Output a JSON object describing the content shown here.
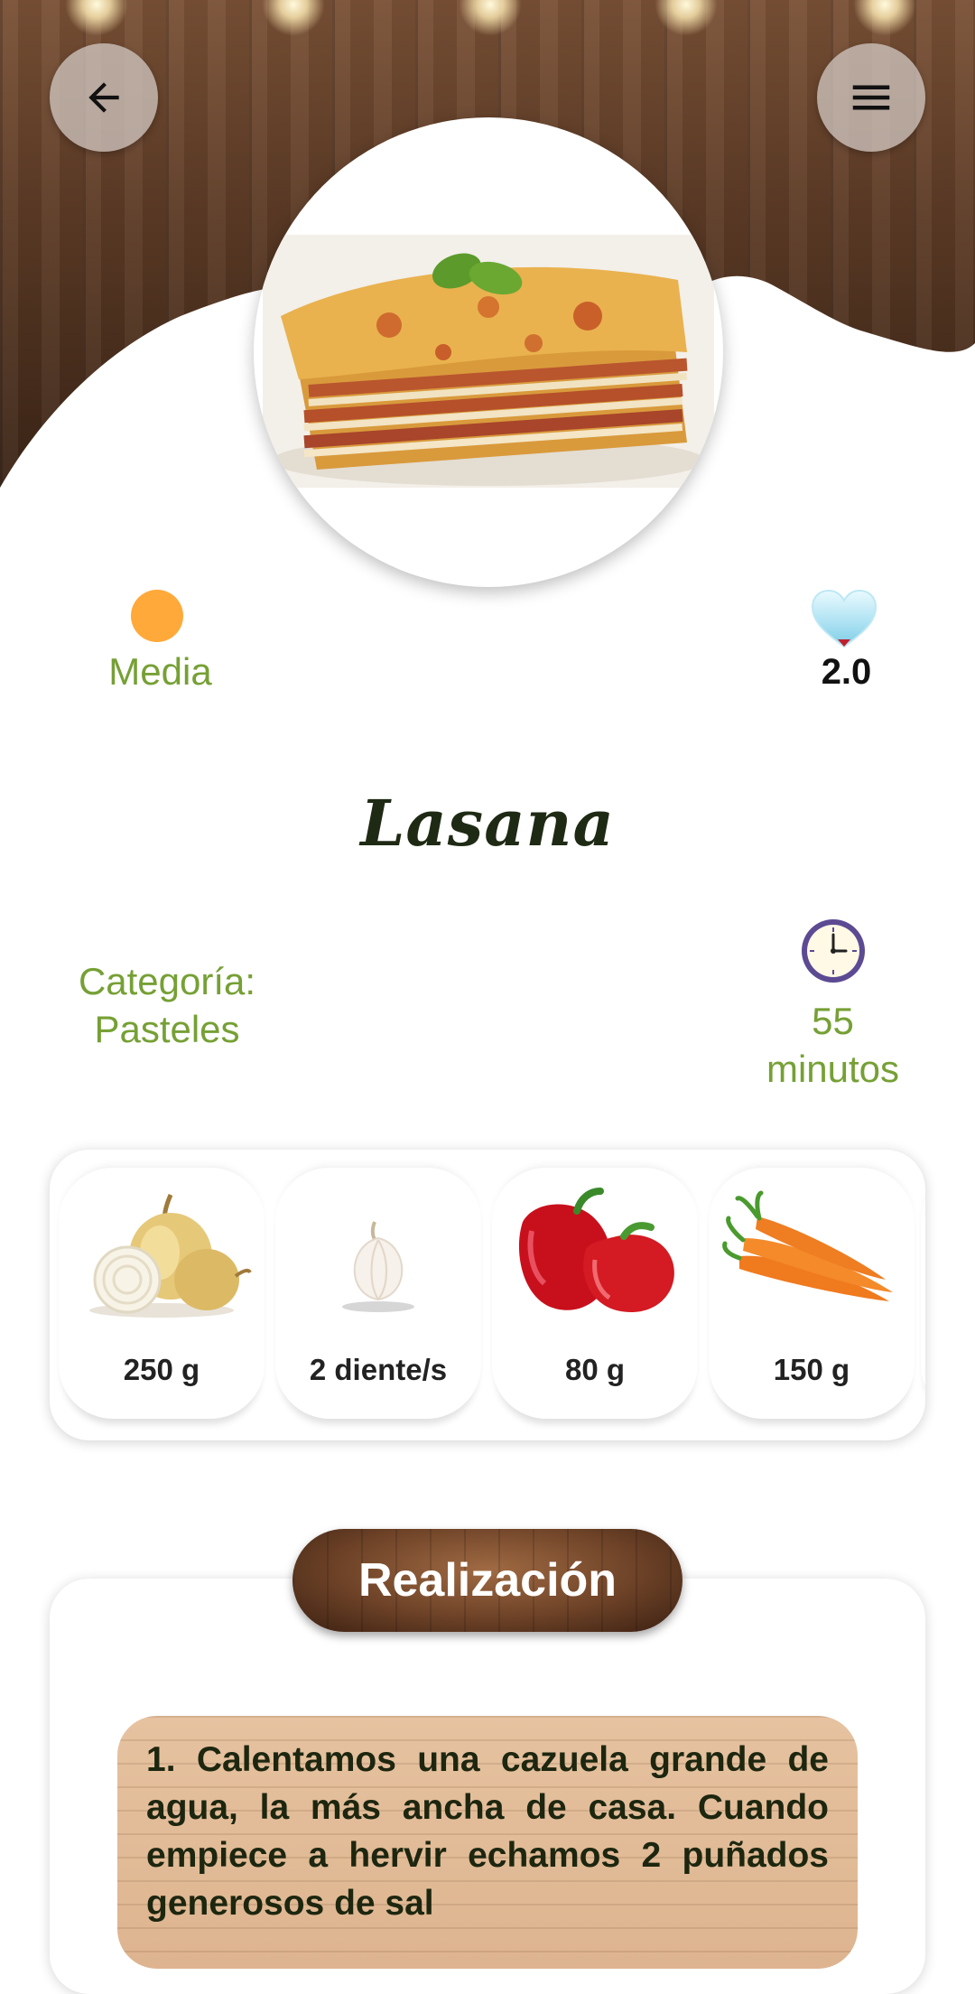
{
  "recipe": {
    "difficulty": "Media",
    "score": "2.0",
    "title": "Lasana",
    "category_label": "Categoría:",
    "category_value": "Pasteles",
    "time_value": "55",
    "time_unit": "minutos"
  },
  "ingredients": [
    {
      "quantity": "250 g",
      "icon": "onion-icon"
    },
    {
      "quantity": "2 diente/s",
      "icon": "garlic-icon"
    },
    {
      "quantity": "80 g",
      "icon": "red-pepper-icon"
    },
    {
      "quantity": "150 g",
      "icon": "carrot-icon"
    }
  ],
  "steps": {
    "button_label": "Realización",
    "items": [
      "1. Calentamos una cazuela grande de agua, la más ancha de casa. Cuando empiece a hervir echamos 2 puñados generosos de sal"
    ]
  },
  "colors": {
    "accent_green": "#76a035",
    "difficulty_dot": "#ffa93a",
    "title_dark": "#1f2a14"
  }
}
